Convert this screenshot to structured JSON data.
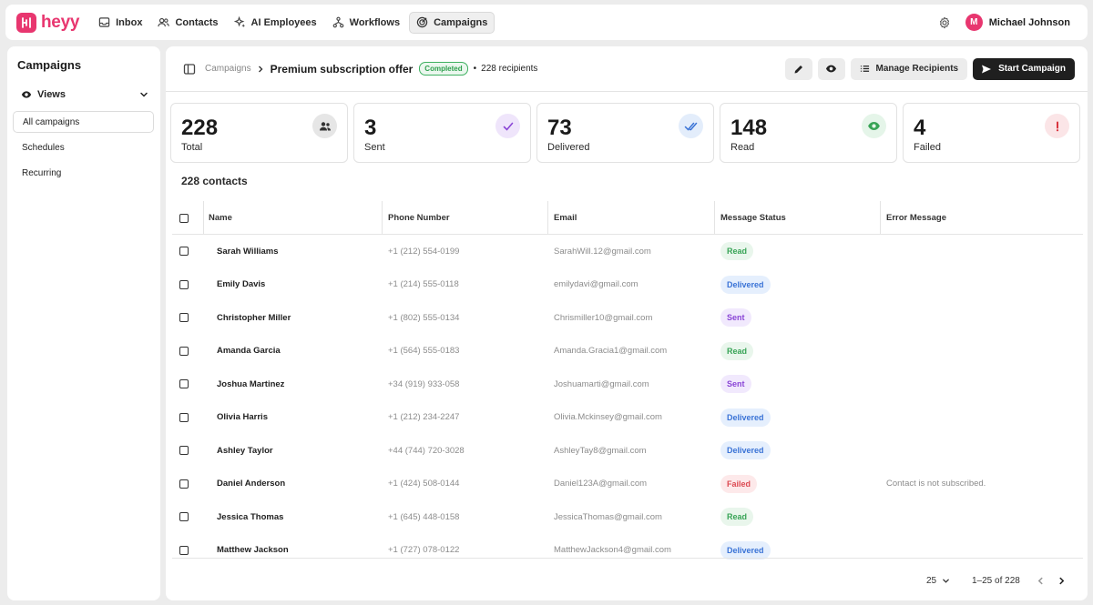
{
  "brand": {
    "name": "heyy",
    "color": "#e8366f"
  },
  "nav": [
    {
      "label": "Inbox",
      "icon": "inbox-icon",
      "active": false
    },
    {
      "label": "Contacts",
      "icon": "contacts-icon",
      "active": false
    },
    {
      "label": "AI Employees",
      "icon": "sparkle-icon",
      "active": false
    },
    {
      "label": "Workflows",
      "icon": "workflow-icon",
      "active": false
    },
    {
      "label": "Campaigns",
      "icon": "campaign-icon",
      "active": true
    }
  ],
  "user": {
    "initial": "M",
    "name": "Michael Johnson"
  },
  "sidebar": {
    "title": "Campaigns",
    "views_label": "Views",
    "items": [
      {
        "label": "All campaigns",
        "active": true
      },
      {
        "label": "Schedules",
        "active": false
      },
      {
        "label": "Recurring",
        "active": false
      }
    ]
  },
  "header": {
    "breadcrumb": "Campaigns",
    "title": "Premium subscription offer",
    "status": "Completed",
    "recipients": "228 recipients",
    "manage_label": "Manage Recipients",
    "start_label": "Start Campaign"
  },
  "stats": [
    {
      "value": "228",
      "label": "Total",
      "icon": "users-icon"
    },
    {
      "value": "3",
      "label": "Sent",
      "icon": "check-icon"
    },
    {
      "value": "73",
      "label": "Delivered",
      "icon": "double-check-icon"
    },
    {
      "value": "148",
      "label": "Read",
      "icon": "eye-icon"
    },
    {
      "value": "4",
      "label": "Failed",
      "icon": "alert-icon"
    }
  ],
  "contacts_count": "228 contacts",
  "table": {
    "columns": [
      "Name",
      "Phone Number",
      "Email",
      "Message Status",
      "Error Message"
    ],
    "rows": [
      {
        "name": "Sarah Williams",
        "phone": "+1 (212) 554-0199",
        "email": "SarahWill.12@gmail.com",
        "status": "Read",
        "error": ""
      },
      {
        "name": "Emily Davis",
        "phone": "+1 (214) 555-0118",
        "email": "emilydavi@gmail.com",
        "status": "Delivered",
        "error": ""
      },
      {
        "name": "Christopher Miller",
        "phone": "+1 (802) 555-0134",
        "email": "Chrismiller10@gmail.com",
        "status": "Sent",
        "error": ""
      },
      {
        "name": "Amanda Garcia",
        "phone": "+1 (564) 555-0183",
        "email": "Amanda.Gracia1@gmail.com",
        "status": "Read",
        "error": ""
      },
      {
        "name": "Joshua Martinez",
        "phone": "+34 (919) 933-058",
        "email": "Joshuamarti@gmail.com",
        "status": "Sent",
        "error": ""
      },
      {
        "name": "Olivia Harris",
        "phone": "+1 (212) 234-2247",
        "email": "Olivia.Mckinsey@gmail.com",
        "status": "Delivered",
        "error": ""
      },
      {
        "name": "Ashley Taylor",
        "phone": "+44 (744) 720-3028",
        "email": "AshleyTay8@gmail.com",
        "status": "Delivered",
        "error": ""
      },
      {
        "name": "Daniel Anderson",
        "phone": "+1 (424) 508-0144",
        "email": "Daniel123A@gmail.com",
        "status": "Failed",
        "error": "Contact is not subscribed."
      },
      {
        "name": "Jessica Thomas",
        "phone": "+1 (645) 448-0158",
        "email": "JessicaThomas@gmail.com",
        "status": "Read",
        "error": ""
      },
      {
        "name": "Matthew Jackson",
        "phone": "+1 (727) 078-0122",
        "email": "MatthewJackson4@gmail.com",
        "status": "Delivered",
        "error": ""
      }
    ]
  },
  "pagination": {
    "per_page": "25",
    "range": "1–25 of 228"
  }
}
